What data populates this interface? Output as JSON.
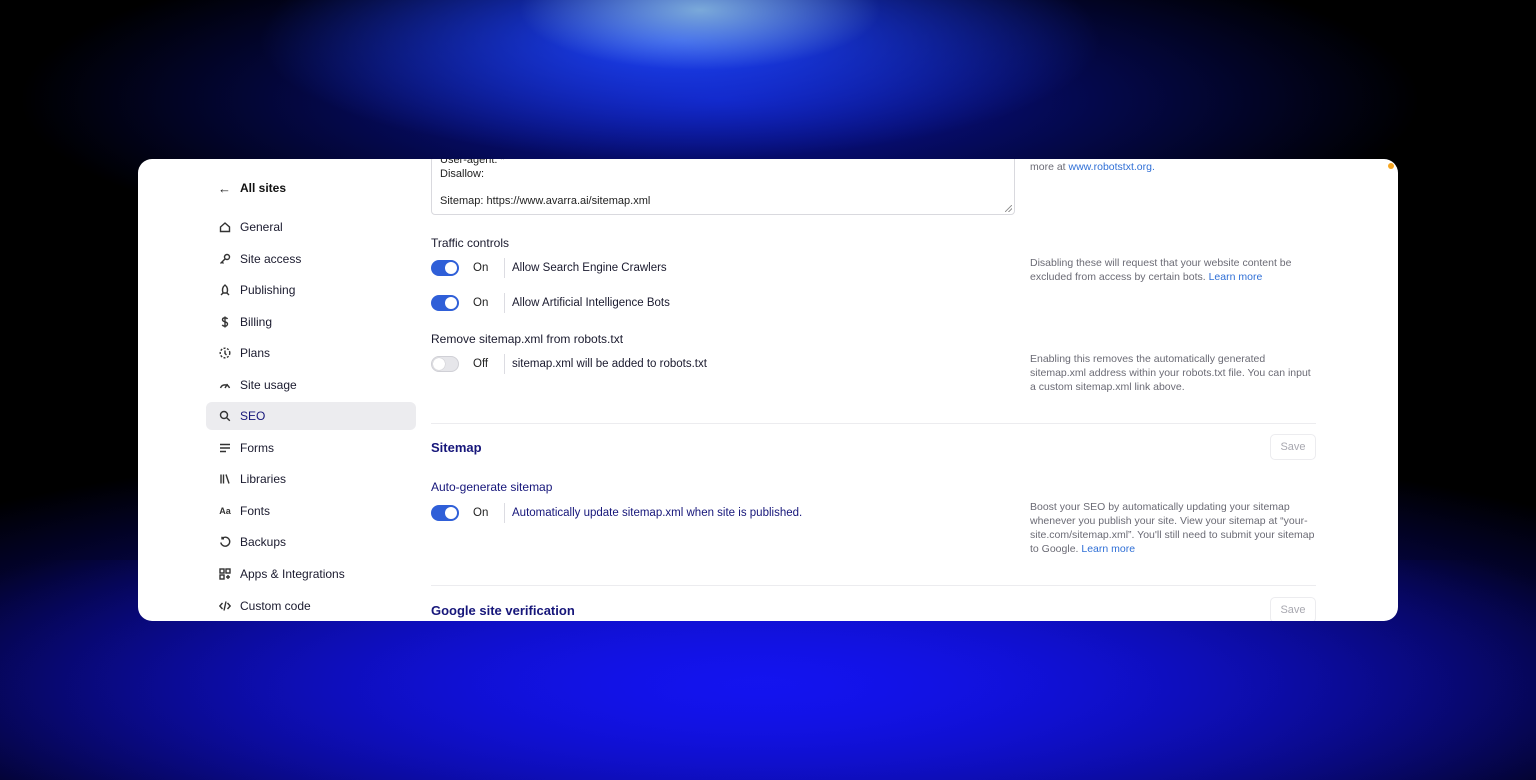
{
  "sidebar": {
    "back_label": "All sites",
    "items": [
      {
        "label": "General",
        "icon": "home-icon"
      },
      {
        "label": "Site access",
        "icon": "key-icon"
      },
      {
        "label": "Publishing",
        "icon": "rocket-icon"
      },
      {
        "label": "Billing",
        "icon": "dollar-icon"
      },
      {
        "label": "Plans",
        "icon": "plans-icon"
      },
      {
        "label": "Site usage",
        "icon": "gauge-icon"
      },
      {
        "label": "SEO",
        "icon": "search-icon",
        "active": true
      },
      {
        "label": "Forms",
        "icon": "forms-icon"
      },
      {
        "label": "Libraries",
        "icon": "libraries-icon"
      },
      {
        "label": "Fonts",
        "icon": "fonts-icon"
      },
      {
        "label": "Backups",
        "icon": "backup-icon"
      },
      {
        "label": "Apps & Integrations",
        "icon": "apps-icon"
      },
      {
        "label": "Custom code",
        "icon": "code-icon"
      }
    ]
  },
  "robots": {
    "lines": [
      "User-agent: *",
      "Disallow:",
      "",
      "Sitemap: https://www.avarra.ai/sitemap.xml"
    ],
    "help_prefix": "more at ",
    "help_link": "www.robotstxt.org."
  },
  "traffic": {
    "label": "Traffic controls",
    "help": "Disabling these will request that your website content be excluded from access by certain bots.",
    "help_link": "Learn more",
    "toggles": [
      {
        "state": "On",
        "text": "Allow Search Engine Crawlers",
        "on": true
      },
      {
        "state": "On",
        "text": "Allow Artificial Intelligence Bots",
        "on": true
      }
    ]
  },
  "remove_sitemap": {
    "label": "Remove sitemap.xml from robots.txt",
    "state": "Off",
    "text": "sitemap.xml will be added to robots.txt",
    "on": false,
    "help": "Enabling this removes the automatically generated sitemap.xml address within your robots.txt file. You can input a custom sitemap.xml link above."
  },
  "sitemap": {
    "title": "Sitemap",
    "save_label": "Save",
    "auto_label": "Auto-generate sitemap",
    "state": "On",
    "text": "Automatically update sitemap.xml when site is published.",
    "on": true,
    "help": "Boost your SEO by automatically updating your sitemap whenever you publish your site. View your sitemap at “your-site.com/sitemap.xml”. You'll still need to submit your sitemap to Google.",
    "help_link": "Learn more"
  },
  "verification": {
    "title": "Google site verification",
    "save_label": "Save"
  },
  "colors": {
    "accent": "#2f5fd8",
    "heading": "#16167a",
    "link": "#2f6fd6"
  }
}
